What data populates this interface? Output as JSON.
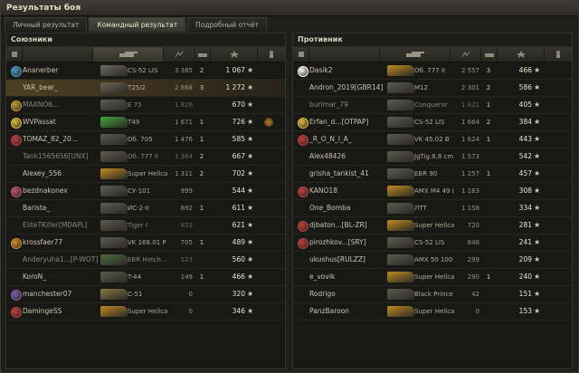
{
  "window": {
    "title": "Результаты боя"
  },
  "tabs": [
    {
      "label": "Личный результат",
      "active": false
    },
    {
      "label": "Командный результат",
      "active": true
    },
    {
      "label": "Подробный отчёт",
      "active": false
    }
  ],
  "allies": {
    "title": "Союзники",
    "rows": [
      {
        "medal": "#4a9ac0",
        "name": "Ananerber",
        "tank": "CS-52 LIS",
        "tankcolor": "#6b6a60",
        "damage": "3 385",
        "kills": "2",
        "xp": "1 067"
      },
      {
        "medal": "",
        "name": "YAR_bear_",
        "tank": "T25/2",
        "tankcolor": "#6a6557",
        "damage": "2 868",
        "kills": "3",
        "xp": "1 272",
        "self": true
      },
      {
        "medal": "#c89b3a",
        "name": "MAXNO6...",
        "tank": "E 75",
        "tankcolor": "#5e5d52",
        "damage": "1 826",
        "kills": "",
        "xp": "670",
        "dim": true
      },
      {
        "medal": "#e0c040",
        "name": "WVPassat",
        "tank": "T49",
        "tankcolor": "#3ea53a",
        "damage": "1 671",
        "kills": "1",
        "xp": "726",
        "ach": "#b08030"
      },
      {
        "medal": "#c04040",
        "name": "TOMAZ_82_20...",
        "tank": "Об. 705",
        "tankcolor": "#5a5a50",
        "damage": "1 476",
        "kills": "1",
        "xp": "585"
      },
      {
        "medal": "",
        "name": "Tank1565656[UNX]",
        "tank": "Об. 777 II",
        "tankcolor": "#5d5c50",
        "damage": "1 364",
        "kills": "2",
        "xp": "667",
        "dim": true
      },
      {
        "medal": "",
        "name": "Alexey_556",
        "tank": "Super Hellcat",
        "tankcolor": "#c08a22",
        "damage": "1 311",
        "kills": "2",
        "xp": "702"
      },
      {
        "medal": "#c05080",
        "name": "bezdnakonex",
        "tank": "СУ-101",
        "tankcolor": "#5a6050",
        "damage": "999",
        "kills": "",
        "xp": "544"
      },
      {
        "medal": "",
        "name": "Barista_",
        "tank": "ИС-2-II",
        "tankcolor": "#5d5d52",
        "damage": "892",
        "kills": "1",
        "xp": "611"
      },
      {
        "medal": "",
        "name": "EliteTKiller[MDAPL]",
        "tank": "Tiger I",
        "tankcolor": "#5c5a4e",
        "damage": "853",
        "kills": "",
        "xp": "621",
        "dim": true
      },
      {
        "medal": "#d09030",
        "name": "krossfaer77",
        "tank": "VK 168.01 P",
        "tankcolor": "#5e5c50",
        "damage": "705",
        "kills": "1",
        "xp": "489"
      },
      {
        "medal": "",
        "name": "Anderyuha1...[P-WOT]",
        "tank": "EBR Hotch...",
        "tankcolor": "#4e6a3e",
        "damage": "523",
        "kills": "",
        "xp": "560",
        "dim": true
      },
      {
        "medal": "",
        "name": "KoroN_",
        "tank": "T-44",
        "tankcolor": "#5c5c50",
        "damage": "149",
        "kills": "1",
        "xp": "466"
      },
      {
        "medal": "#8060b0",
        "name": "manchester07",
        "tank": "C-51",
        "tankcolor": "#8a7a45",
        "damage": "0",
        "kills": "",
        "xp": "320"
      },
      {
        "medal": "#c04040",
        "name": "DamingeSS",
        "tank": "Super Hellcat",
        "tankcolor": "#c08a22",
        "damage": "0",
        "kills": "",
        "xp": "346"
      }
    ]
  },
  "enemies": {
    "title": "Противник",
    "rows": [
      {
        "medal": "#ffffff",
        "name": "Dasik2",
        "tank": "Об. 777 II",
        "tankcolor": "#c08a22",
        "damage": "2 557",
        "kills": "3",
        "xp": "466"
      },
      {
        "medal": "",
        "name": "Andron_2019[GBR14]",
        "tank": "M12",
        "tankcolor": "#5e5c50",
        "damage": "2 301",
        "kills": "2",
        "xp": "586"
      },
      {
        "medal": "",
        "name": "burimar_79",
        "tank": "Conqueror",
        "tankcolor": "#5d5c52",
        "damage": "1 821",
        "kills": "1",
        "xp": "405",
        "dim": true
      },
      {
        "medal": "#e0c040",
        "name": "Erfan_d...[OTPAP]",
        "tank": "CS-52 LIS",
        "tankcolor": "#5e5d52",
        "damage": "1 664",
        "kills": "2",
        "xp": "384"
      },
      {
        "medal": "#c04040",
        "name": "_R_O_N_I_A_",
        "tank": "VK 45.02 B",
        "tankcolor": "#5c5a50",
        "damage": "1 624",
        "kills": "1",
        "xp": "443"
      },
      {
        "medal": "",
        "name": "Alex48426",
        "tank": "JgTig.8,8 cm",
        "tankcolor": "#5c5a4e",
        "damage": "1 573",
        "kills": "",
        "xp": "542"
      },
      {
        "medal": "",
        "name": "grisha_tankist_41",
        "tank": "EBR 90",
        "tankcolor": "#5d5d52",
        "damage": "1 257",
        "kills": "1",
        "xp": "457"
      },
      {
        "medal": "#c04040",
        "name": "KANO18",
        "tank": "AMX M4 49 L...",
        "tankcolor": "#c08a22",
        "damage": "1 163",
        "kills": "",
        "xp": "308"
      },
      {
        "medal": "",
        "name": "One_Bomba",
        "tank": "ЛТТ",
        "tankcolor": "#5c5b50",
        "damage": "1 158",
        "kills": "",
        "xp": "334"
      },
      {
        "medal": "#c04040",
        "name": "djbaton...[BL-ZR]",
        "tank": "Super Hellcat",
        "tankcolor": "#c08a22",
        "damage": "720",
        "kills": "",
        "xp": "281"
      },
      {
        "medal": "#c04040",
        "name": "pirozhkov...[SRY]",
        "tank": "CS-52 LIS",
        "tankcolor": "#5e5d52",
        "damage": "648",
        "kills": "",
        "xp": "241"
      },
      {
        "medal": "",
        "name": "ukushus[RULZZ]",
        "tank": "AMX 50 100",
        "tankcolor": "#5d5c50",
        "damage": "299",
        "kills": "",
        "xp": "209"
      },
      {
        "medal": "",
        "name": "e_vovik",
        "tank": "Super Hellcat",
        "tankcolor": "#c08a22",
        "damage": "290",
        "kills": "1",
        "xp": "240"
      },
      {
        "medal": "",
        "name": "Rodrigo",
        "tank": "Black Prince",
        "tankcolor": "#5c5b50",
        "damage": "42",
        "kills": "",
        "xp": "151"
      },
      {
        "medal": "",
        "name": "PanzBaroon",
        "tank": "Super Hellcat",
        "tankcolor": "#c08a22",
        "damage": "0",
        "kills": "",
        "xp": "153"
      }
    ]
  },
  "star_glyph": "★"
}
